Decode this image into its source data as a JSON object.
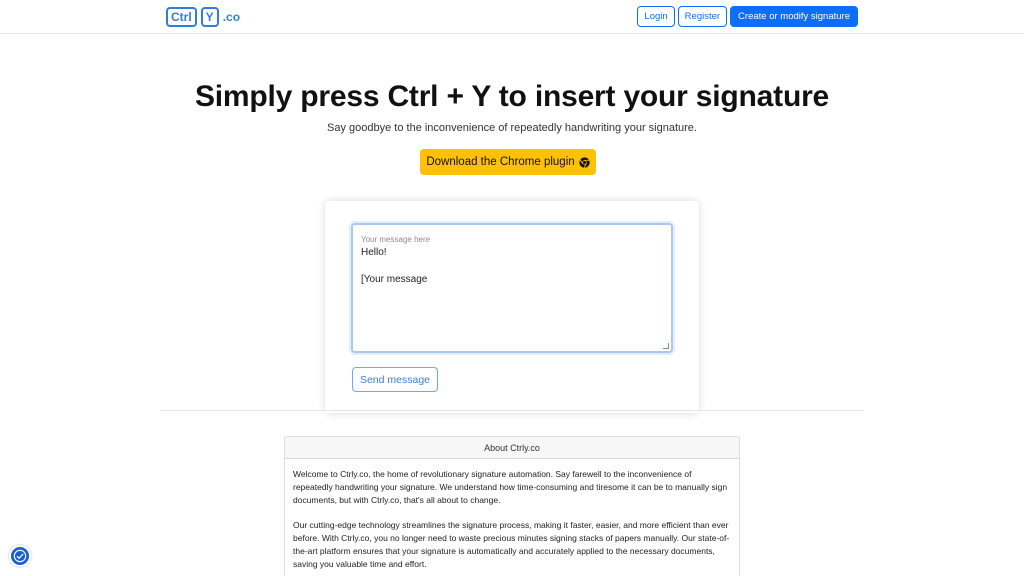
{
  "navbar": {
    "logo": {
      "part1": "Ctrl",
      "part2": "Y",
      "suffix": ".co"
    },
    "login_label": "Login",
    "register_label": "Register",
    "create_label": "Create or modify signature"
  },
  "hero": {
    "title": "Simply press Ctrl + Y to insert your signature",
    "subtitle": "Say goodbye to the inconvenience of repeatedly handwriting your signature.",
    "download_label": "Download the Chrome plugin",
    "download_icon": "chrome-icon"
  },
  "message_form": {
    "placeholder": "Your message here",
    "line1": "Hello!",
    "line2": "[Your message",
    "send_label": "Send message"
  },
  "about": {
    "title": "About Ctrly.co",
    "paragraphs": [
      "Welcome to Ctrly.co, the home of revolutionary signature automation. Say farewell to the inconvenience of repeatedly handwriting your signature. We understand how time-consuming and tiresome it can be to manually sign documents, but with Ctrly.co, that's all about to change.",
      "Our cutting-edge technology streamlines the signature process, making it faster, easier, and more efficient than ever before. With Ctrly.co, you no longer need to waste precious minutes signing stacks of papers manually. Our state-of-the-art platform ensures that your signature is automatically and accurately applied to the necessary documents, saving you valuable time and effort."
    ]
  },
  "colors": {
    "primary": "#0d6efd",
    "warning": "#ffc107",
    "logo": "#2f7fd8"
  },
  "accessibility_icon": "accessibility-icon"
}
